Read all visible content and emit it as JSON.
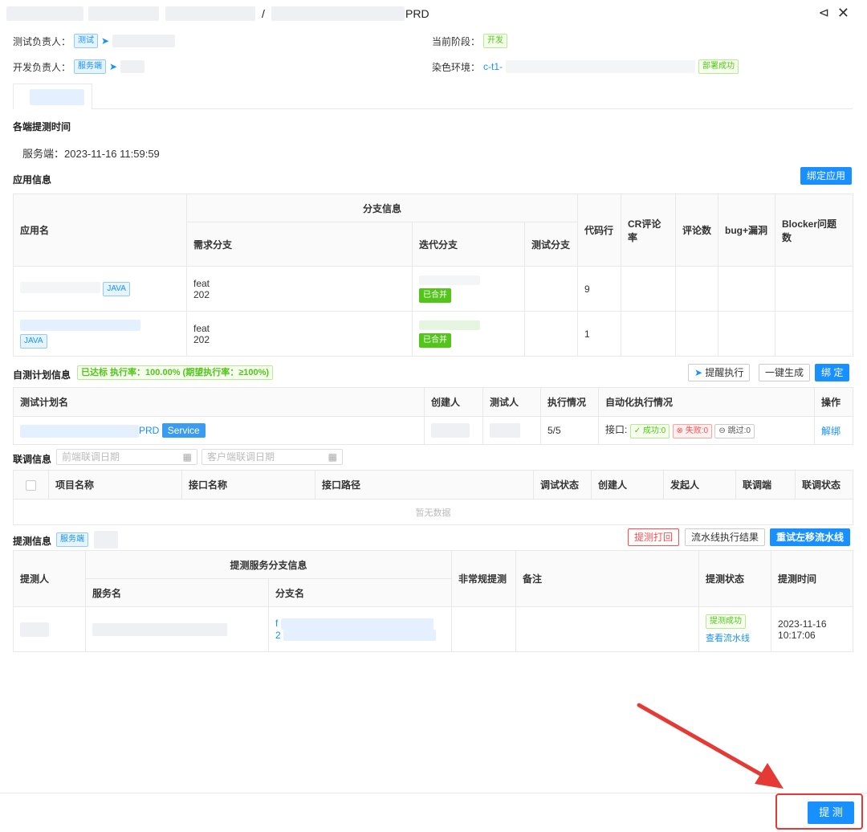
{
  "header": {
    "title_suffix": "PRD",
    "separator": "/",
    "share_icon": "share-icon",
    "close_icon": "close-icon"
  },
  "info": {
    "test_owner_label": "测试负责人：",
    "test_owner_tag": "测试",
    "dev_owner_label": "开发负责人：",
    "dev_owner_tag": "服务端",
    "stage_label": "当前阶段：",
    "stage_value": "开发",
    "env_label": "染色环境：",
    "env_value": "c-t1-",
    "env_status": "部署成功"
  },
  "submit_time": {
    "title": "各端提测时间",
    "server_line": "服务端：2023-11-16 11:59:59"
  },
  "app_info": {
    "title": "应用信息",
    "bind_button": "绑定应用",
    "headers": {
      "app_name": "应用名",
      "branch_info": "分支信息",
      "req_branch": "需求分支",
      "iter_branch": "迭代分支",
      "test_branch": "测试分支",
      "code_lines": "代码行",
      "cr_rate": "CR评论率",
      "comments": "评论数",
      "bugs": "bug+漏洞",
      "blocker": "Blocker问题数"
    },
    "rows": [
      {
        "lang": "JAVA",
        "req_prefix": "feat",
        "req_year": "202",
        "merged": "已合并",
        "code": "9"
      },
      {
        "lang": "JAVA",
        "req_prefix": "feat",
        "req_year": "202",
        "merged": "已合并",
        "code": "1"
      }
    ]
  },
  "selftest": {
    "title": "自测计划信息",
    "badge": "已达标 执行率：100.00% (期望执行率：≥100%)",
    "remind_button": "提醒执行",
    "generate_button": "一键生成",
    "bind_button": "绑 定",
    "headers": {
      "plan_name": "测试计划名",
      "creator": "创建人",
      "tester": "测试人",
      "exec": "执行情况",
      "auto": "自动化执行情况",
      "action": "操作"
    },
    "row": {
      "plan_suffix": "PRD",
      "plan_tag": "Service",
      "exec": "5/5",
      "api_label": "接口:",
      "success": "成功:0",
      "fail": "失败:0",
      "skip": "跳过:0",
      "action": "解绑"
    }
  },
  "joint": {
    "title": "联调信息",
    "front_date_placeholder": "前端联调日期",
    "client_date_placeholder": "客户端联调日期",
    "headers": {
      "project": "项目名称",
      "api_name": "接口名称",
      "api_path": "接口路径",
      "debug_status": "调试状态",
      "creator": "创建人",
      "initiator": "发起人",
      "joint_end": "联调端",
      "joint_status": "联调状态"
    },
    "empty": "暂无数据"
  },
  "submit_info": {
    "title": "提测信息",
    "tag": "服务端",
    "reject_button": "提测打回",
    "pipeline_button": "流水线执行结果",
    "retry_button": "重试左移流水线",
    "headers": {
      "submitter": "提测人",
      "service_branch": "提测服务分支信息",
      "service_name": "服务名",
      "branch_name": "分支名",
      "irregular": "非常规提测",
      "remark": "备注",
      "status": "提测状态",
      "time": "提测时间"
    },
    "row": {
      "branch_1": "f",
      "branch_2": "2",
      "status": "提测成功",
      "view_pipeline": "查看流水线",
      "time_date": "2023-11-16",
      "time_clock": "10:17:06"
    }
  },
  "footer": {
    "submit_button": "提 测"
  },
  "colors": {
    "primary": "#1890ff",
    "success": "#52c41a",
    "danger": "#ff4d4f",
    "annotation": "#e53935"
  }
}
